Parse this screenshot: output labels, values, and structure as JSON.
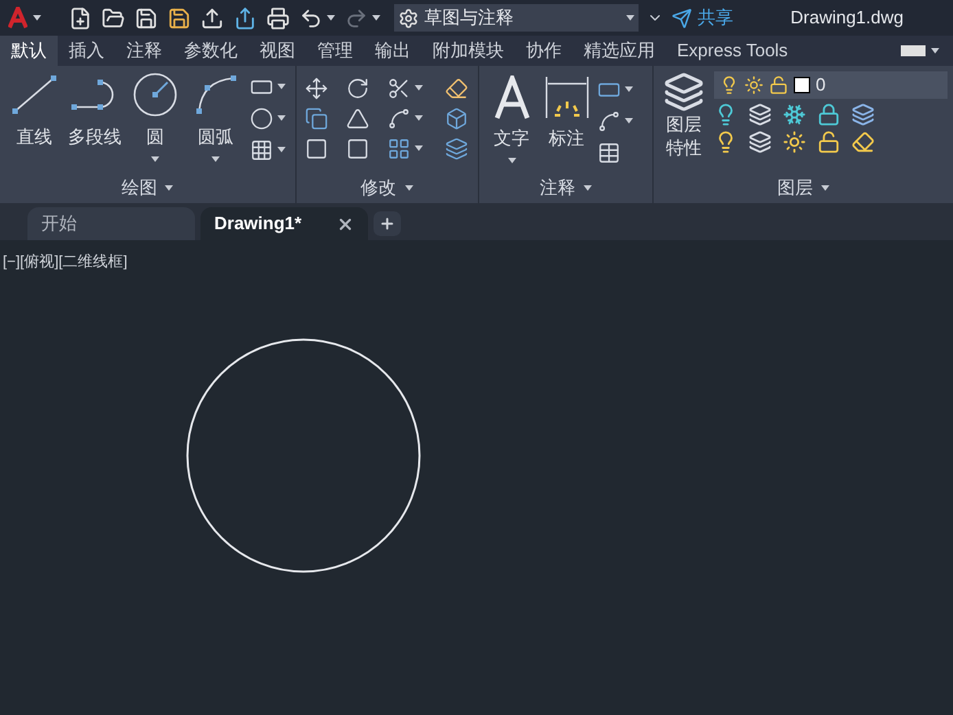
{
  "title_bar": {
    "workspace": "草图与注释",
    "share": "共享",
    "document_title": "Drawing1.dwg"
  },
  "ribbon_tabs": [
    {
      "label": "默认",
      "selected": true
    },
    {
      "label": "插入",
      "selected": false
    },
    {
      "label": "注释",
      "selected": false
    },
    {
      "label": "参数化",
      "selected": false
    },
    {
      "label": "视图",
      "selected": false
    },
    {
      "label": "管理",
      "selected": false
    },
    {
      "label": "输出",
      "selected": false
    },
    {
      "label": "附加模块",
      "selected": false
    },
    {
      "label": "协作",
      "selected": false
    },
    {
      "label": "精选应用",
      "selected": false
    },
    {
      "label": "Express Tools",
      "selected": false
    }
  ],
  "panels": {
    "draw": {
      "title": "绘图",
      "tools": [
        {
          "label": "直线",
          "kind": "line"
        },
        {
          "label": "多段线",
          "kind": "polyline"
        },
        {
          "label": "圆",
          "kind": "circle"
        },
        {
          "label": "圆弧",
          "kind": "arc"
        }
      ]
    },
    "modify": {
      "title": "修改"
    },
    "annotation": {
      "title": "注释",
      "tools": [
        {
          "label": "文字",
          "kind": "text"
        },
        {
          "label": "标注",
          "kind": "dimension"
        }
      ]
    },
    "layers": {
      "title": "图层",
      "properties_label": [
        "图层",
        "特性"
      ],
      "current_layer": "0"
    }
  },
  "document_tabs": [
    {
      "label": "开始",
      "selected": false
    },
    {
      "label": "Drawing1*",
      "selected": true
    }
  ],
  "viewport_label": "[−][俯视][二维线框]"
}
